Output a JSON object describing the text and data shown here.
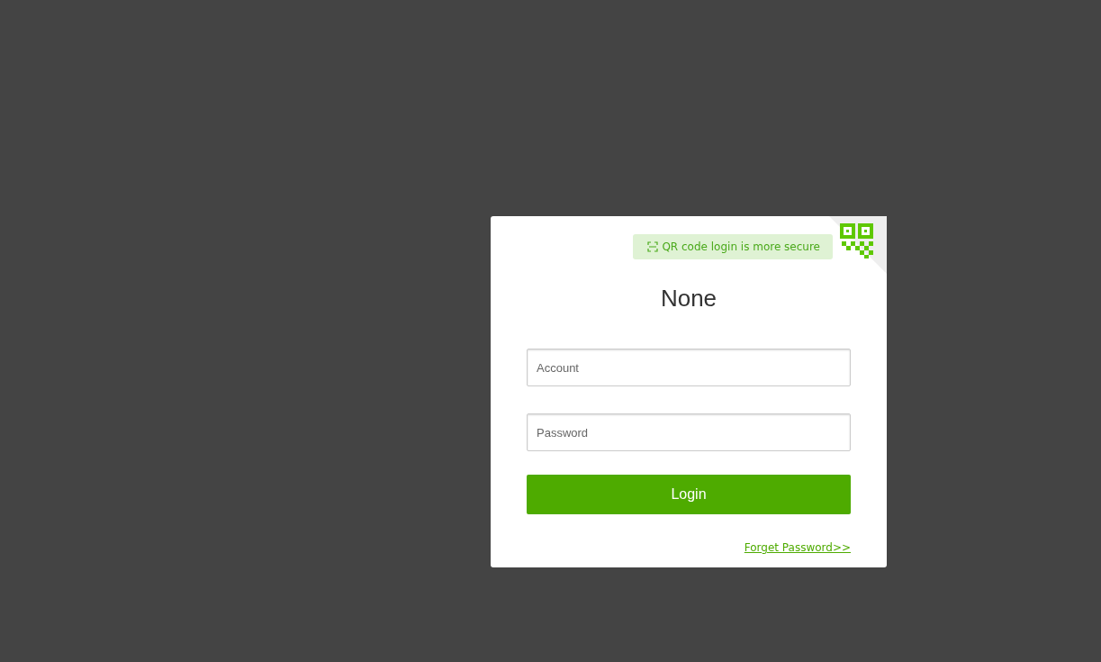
{
  "qr_tip": {
    "text": "QR code login is more secure"
  },
  "title": "None",
  "fields": [
    {
      "placeholder": "Account"
    },
    {
      "placeholder": "Password"
    }
  ],
  "login_button": "Login",
  "forgot_link": "Forget Password>>"
}
